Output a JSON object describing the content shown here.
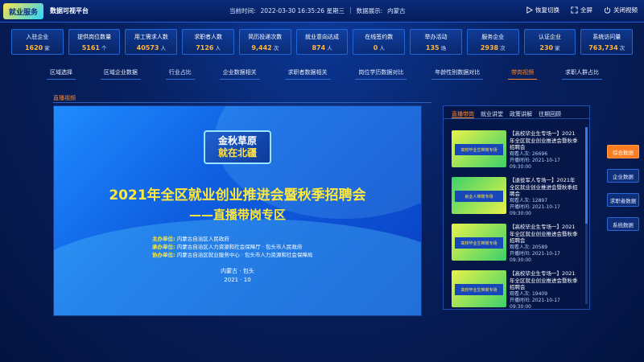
{
  "header": {
    "logo": "就业服务",
    "platform_title": "数据可视平台",
    "time_label": "当前时间:",
    "time_value": "2022-03-30 16:35:26 星期三",
    "sep": "|",
    "display_label": "数据展示:",
    "display_value": "内蒙古",
    "restore_label": "恢复切换",
    "fullscreen_label": "全屏",
    "close_label": "关闭视频"
  },
  "stats": [
    {
      "label": "入驻企业",
      "value": "1620",
      "unit": "家"
    },
    {
      "label": "提供岗位数量",
      "value": "5161",
      "unit": "个"
    },
    {
      "label": "用工需求人数",
      "value": "40573",
      "unit": "人"
    },
    {
      "label": "求职者人数",
      "value": "7126",
      "unit": "人"
    },
    {
      "label": "简历投递次数",
      "value": "9,442",
      "unit": "次"
    },
    {
      "label": "就业意向达成",
      "value": "874",
      "unit": "人"
    },
    {
      "label": "在线签约数",
      "value": "0",
      "unit": "人"
    },
    {
      "label": "举办活动",
      "value": "135",
      "unit": "场"
    },
    {
      "label": "服务企业",
      "value": "2938",
      "unit": "次"
    },
    {
      "label": "认证企业",
      "value": "230",
      "unit": "家"
    },
    {
      "label": "系统访问量",
      "value": "763,734",
      "unit": "次"
    }
  ],
  "tabs": [
    {
      "label": "区域选择",
      "active": false
    },
    {
      "label": "区域企业数据",
      "active": false
    },
    {
      "label": "行业占比",
      "active": false
    },
    {
      "label": "企业数据相关",
      "active": false
    },
    {
      "label": "求职者数据相关",
      "active": false
    },
    {
      "label": "岗位学历数据对比",
      "active": false
    },
    {
      "label": "年龄性别数据对比",
      "active": false
    },
    {
      "label": "带岗视频",
      "active": true
    },
    {
      "label": "求职人群占比",
      "active": false
    }
  ],
  "section_label": "直播视频",
  "video": {
    "badge_line1": "金秋草原",
    "badge_line2": "就在北疆",
    "title": "2021年全区就业创业推进会暨秋季招聘会",
    "subtitle": "——直播带岗专区",
    "org1_key": "主办单位:",
    "org1_val": "内蒙古自治区人民政府",
    "org2_key": "承办单位:",
    "org2_val": "内蒙古自治区人力资源和社会保障厅 · 包头市人民政府",
    "org3_key": "协办单位:",
    "org3_val": "内蒙古自治区就业服务中心 · 包头市人力资源和社会保障局",
    "place": "内蒙古 · 包头",
    "date": "2021 · 10"
  },
  "panel": {
    "tabs": [
      {
        "label": "直播带岗",
        "active": true
      },
      {
        "label": "就业讲堂",
        "active": false
      },
      {
        "label": "政策讲解",
        "active": false
      },
      {
        "label": "往期回顾",
        "active": false
      }
    ],
    "items": [
      {
        "thumb": "高校毕业生带岗专场",
        "title": "【高校毕业生专场一】2021年全区就业创业推进会暨秋季招聘会",
        "views_label": "观看人次:",
        "views": "26696",
        "time_label": "开播时间:",
        "time": "2021-10-17 09:30:00"
      },
      {
        "thumb": "就业人带岗专场",
        "title": "【退役军人专场一】2021年全区就业创业推进会暨秋季招聘会",
        "views_label": "观看人次:",
        "views": "12897",
        "time_label": "开播时间:",
        "time": "2021-10-17 09:30:00"
      },
      {
        "thumb": "高校毕业生带岗专场",
        "title": "【高校毕业生专场一】2021年全区就业创业推进会暨秋季招聘会",
        "views_label": "观看人次:",
        "views": "20589",
        "time_label": "开播时间:",
        "time": "2021-10-17 09:30:00"
      },
      {
        "thumb": "高校毕业生带岗专场",
        "title": "【高校毕业生专场一】2021年全区就业创业推进会暨秋季招聘会",
        "views_label": "观看人次:",
        "views": "19409",
        "time_label": "开播时间:",
        "time": "2021-10-17 09:30:00"
      }
    ]
  },
  "side_buttons": [
    {
      "label": "综合数据",
      "active": true
    },
    {
      "label": "企业数据",
      "active": false
    },
    {
      "label": "求职者数据",
      "active": false
    },
    {
      "label": "系统数据",
      "active": false
    }
  ]
}
